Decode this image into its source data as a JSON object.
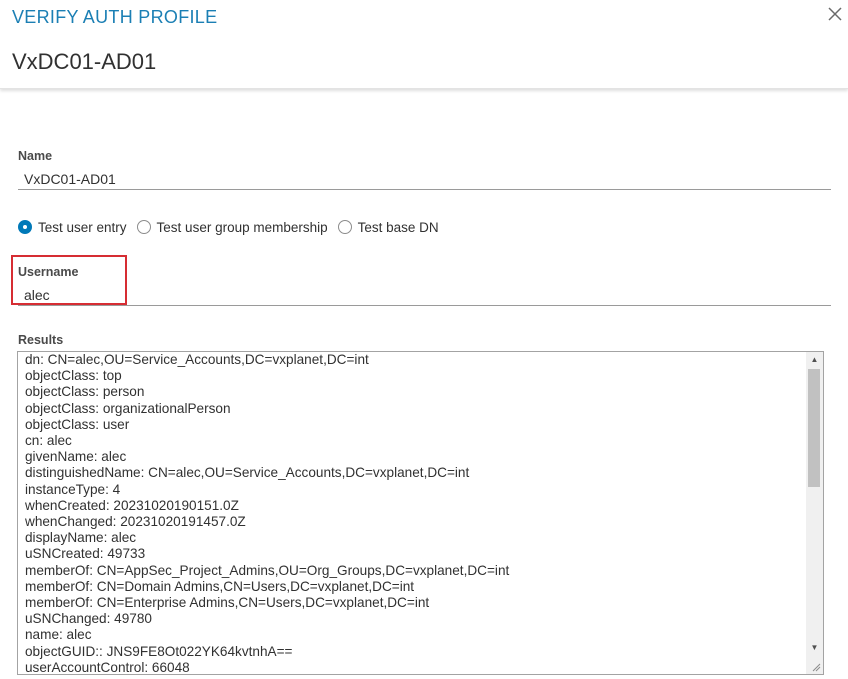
{
  "dialog": {
    "title": "VERIFY AUTH PROFILE",
    "subtitle": "VxDC01-AD01",
    "close_icon": "close-icon"
  },
  "name_field": {
    "label": "Name",
    "value": "VxDC01-AD01"
  },
  "test_options": {
    "selected": "Test user entry",
    "options": [
      {
        "label": "Test user entry",
        "checked": true
      },
      {
        "label": "Test user group membership",
        "checked": false
      },
      {
        "label": "Test base DN",
        "checked": false
      }
    ]
  },
  "username_field": {
    "label": "Username",
    "value": "alec"
  },
  "results": {
    "label": "Results",
    "lines": [
      "dn: CN=alec,OU=Service_Accounts,DC=vxplanet,DC=int",
      "objectClass: top",
      "objectClass: person",
      "objectClass: organizationalPerson",
      "objectClass: user",
      "cn: alec",
      "givenName: alec",
      "distinguishedName: CN=alec,OU=Service_Accounts,DC=vxplanet,DC=int",
      "instanceType: 4",
      "whenCreated: 20231020190151.0Z",
      "whenChanged: 20231020191457.0Z",
      "displayName: alec",
      "uSNCreated: 49733",
      "memberOf: CN=AppSec_Project_Admins,OU=Org_Groups,DC=vxplanet,DC=int",
      "memberOf: CN=Domain Admins,CN=Users,DC=vxplanet,DC=int",
      "memberOf: CN=Enterprise Admins,CN=Users,DC=vxplanet,DC=int",
      "uSNChanged: 49780",
      "name: alec",
      "objectGUID:: JNS9FE8Ot022YK64kvtnhA==",
      "userAccountControl: 66048"
    ]
  },
  "colors": {
    "title_blue": "#1b7fb4",
    "radio_selected": "#0079b8",
    "highlight_red": "#d62d33"
  }
}
